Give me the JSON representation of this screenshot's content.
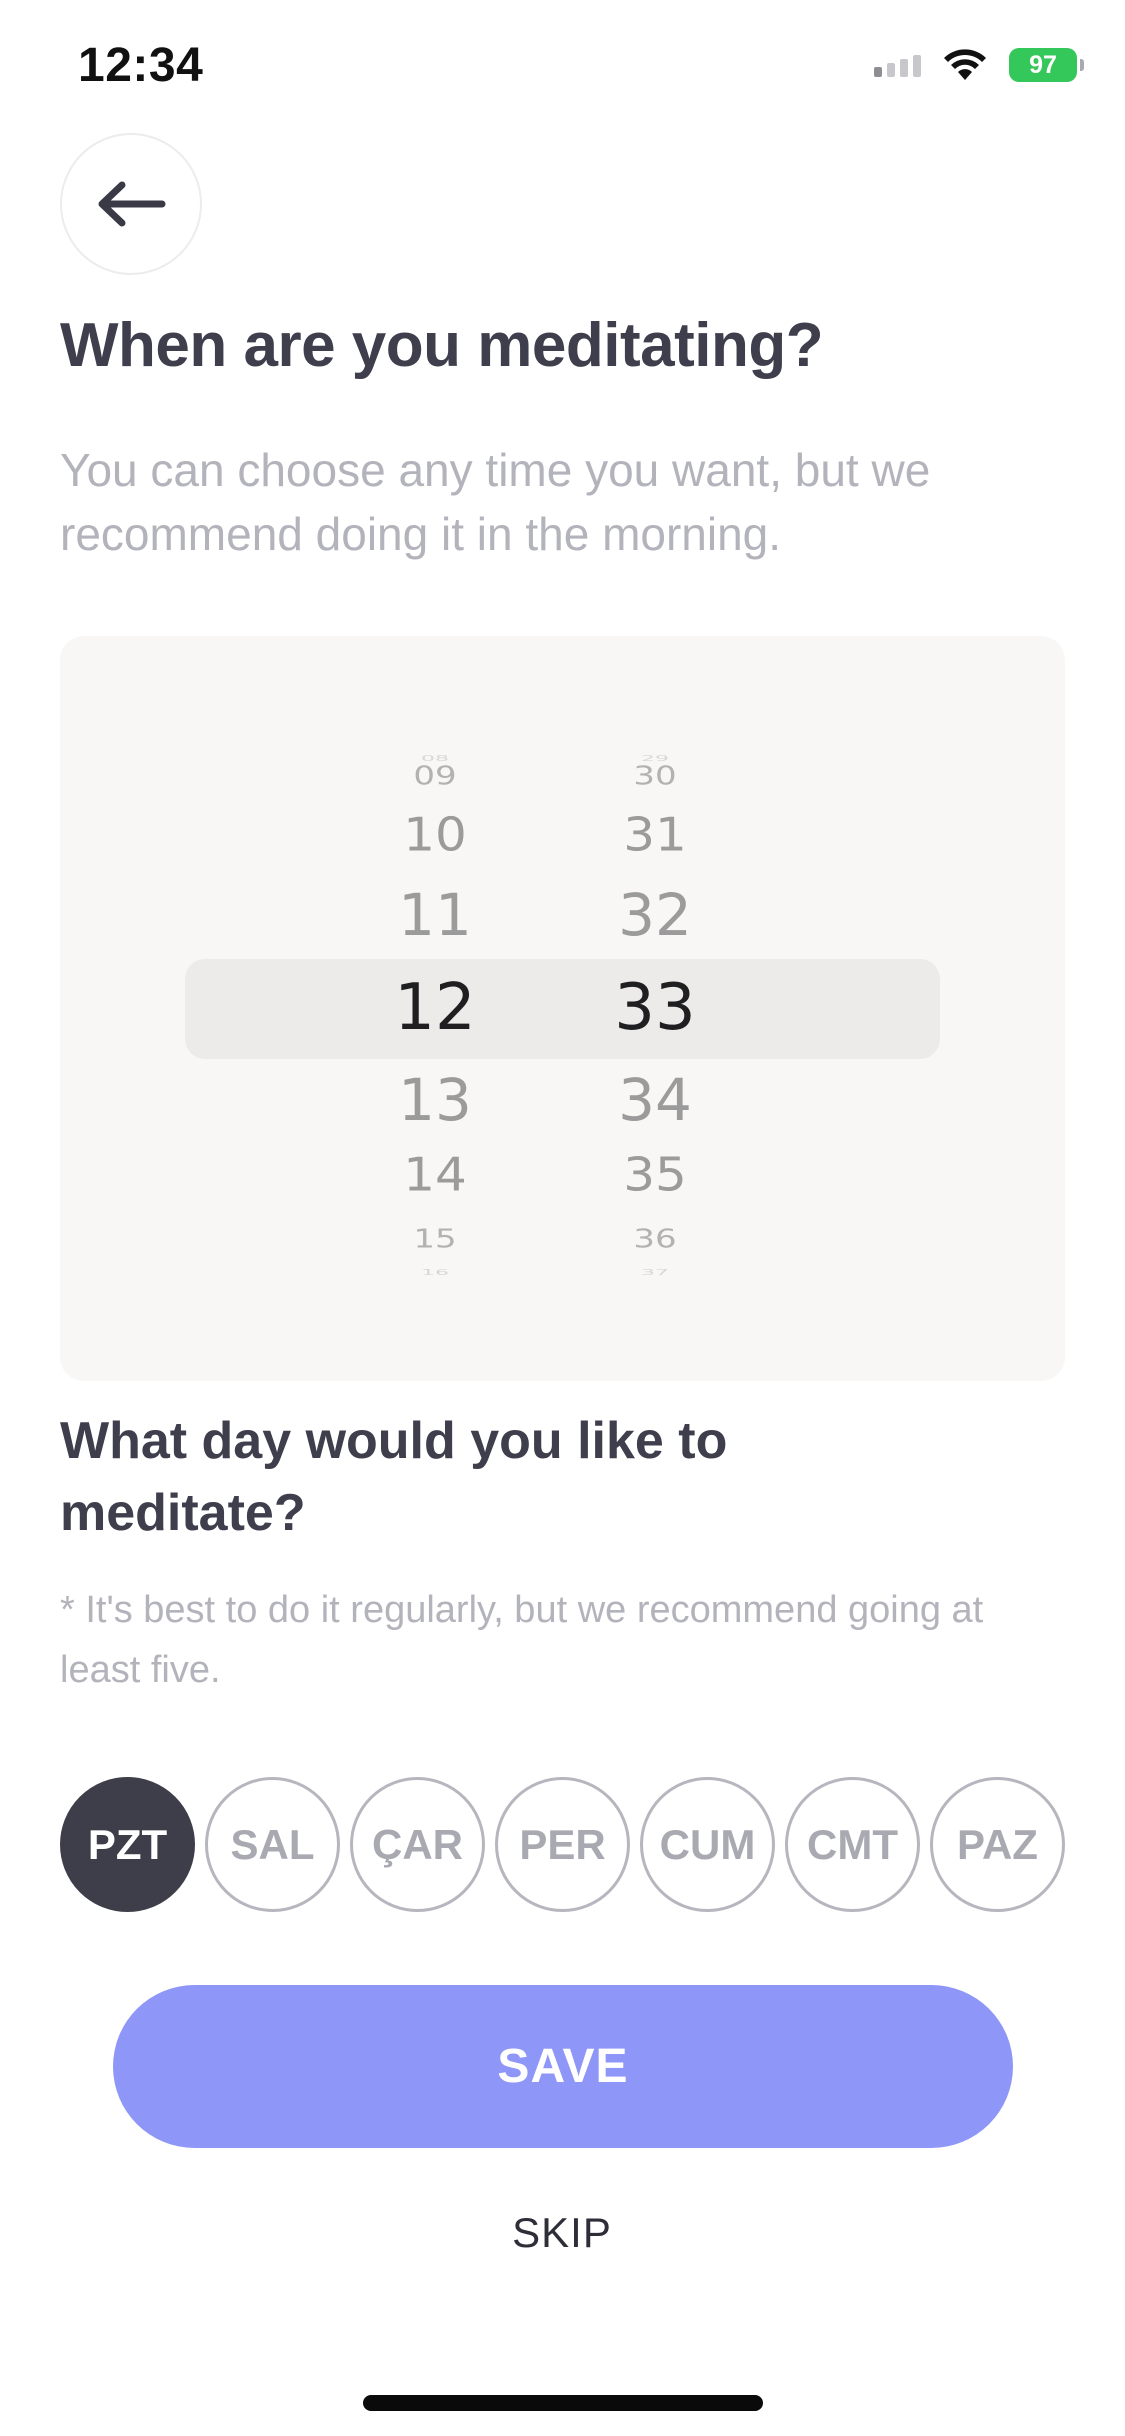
{
  "status_bar": {
    "time": "12:34",
    "battery": "97",
    "battery_color": "#34c759"
  },
  "header": {
    "back_icon": "arrow-left-icon",
    "title": "When are you meditating?",
    "subtitle": "You can choose any time you want, but we recommend doing it in the morning."
  },
  "time_picker": {
    "hours": [
      "08",
      "09",
      "10",
      "11",
      "12",
      "13",
      "14",
      "15",
      "16"
    ],
    "minutes": [
      "29",
      "30",
      "31",
      "32",
      "33",
      "34",
      "35",
      "36",
      "37"
    ],
    "selected_hour": "12",
    "selected_minute": "33"
  },
  "days": {
    "title": "What day would you like to meditate?",
    "note": "* It's best to do it regularly, but we recommend going at least five.",
    "items": [
      {
        "label": "PZT",
        "selected": true
      },
      {
        "label": "SAL",
        "selected": false
      },
      {
        "label": "ÇAR",
        "selected": false
      },
      {
        "label": "PER",
        "selected": false
      },
      {
        "label": "CUM",
        "selected": false
      },
      {
        "label": "CMT",
        "selected": false
      },
      {
        "label": "PAZ",
        "selected": false
      }
    ]
  },
  "actions": {
    "save_label": "SAVE",
    "skip_label": "SKIP",
    "accent_color": "#8e96f8"
  }
}
